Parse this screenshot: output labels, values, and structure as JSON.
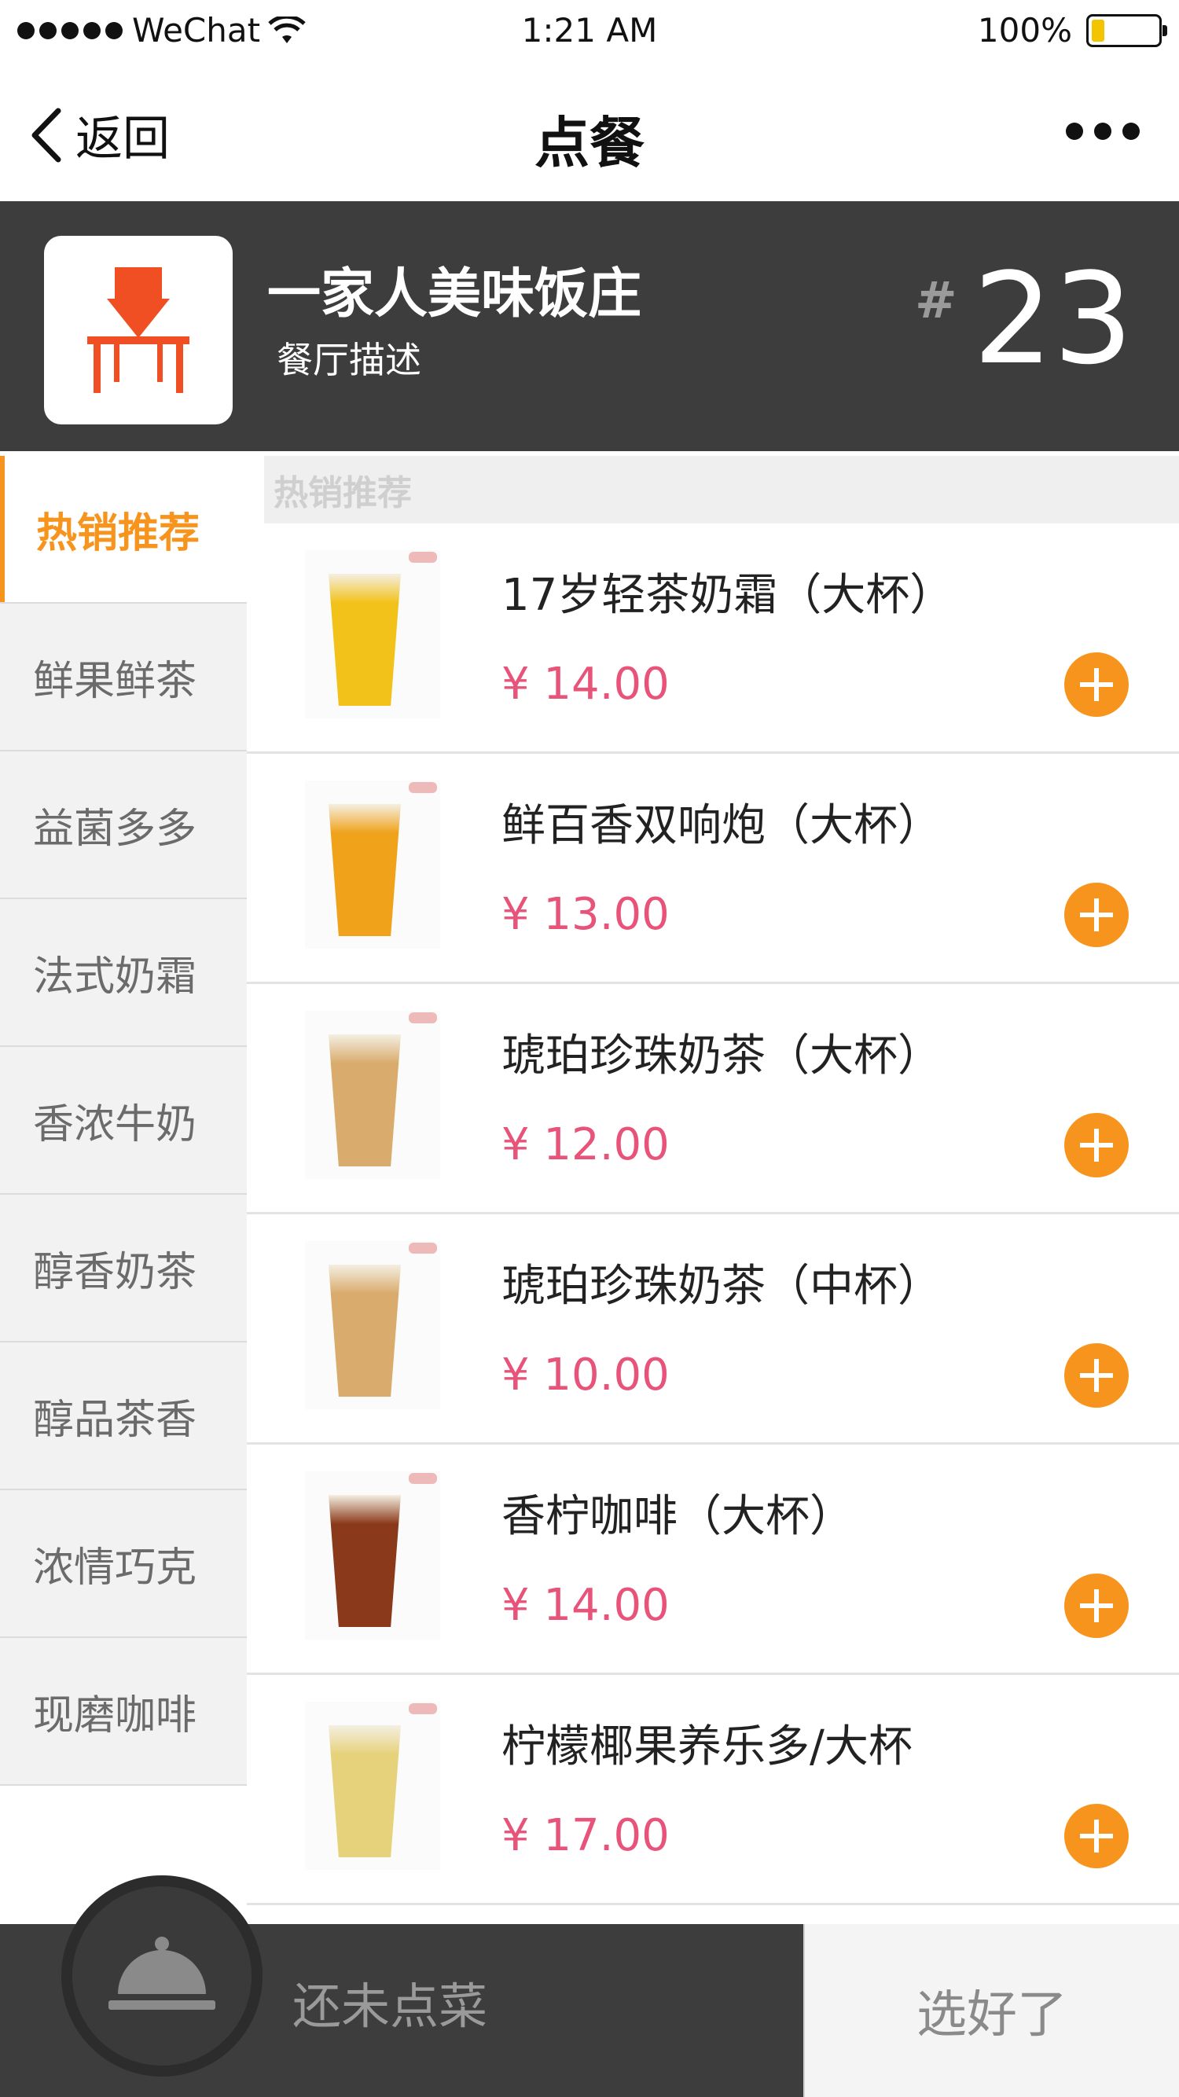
{
  "status_bar": {
    "carrier": "WeChat",
    "time": "1:21 AM",
    "battery_pct": "100%"
  },
  "nav": {
    "back_label": "返回",
    "title": "点餐"
  },
  "restaurant": {
    "name": "一家人美味饭庄",
    "description": "餐厅描述",
    "table_hash": "#",
    "table_number": "23"
  },
  "sidebar": {
    "categories": [
      {
        "label": "热销推荐",
        "active": true
      },
      {
        "label": "鲜果鲜茶"
      },
      {
        "label": "益菌多多"
      },
      {
        "label": "法式奶霜"
      },
      {
        "label": "香浓牛奶"
      },
      {
        "label": "醇香奶茶"
      },
      {
        "label": "醇品茶香"
      },
      {
        "label": "浓情巧克"
      },
      {
        "label": "现磨咖啡"
      }
    ]
  },
  "menu": {
    "section_title": "热销推荐",
    "items": [
      {
        "name": "17岁轻茶奶霜（大杯）",
        "price": "¥ 14.00",
        "color": "#f2c21a"
      },
      {
        "name": "鲜百香双响炮（大杯）",
        "price": "¥ 13.00",
        "color": "#f0a21a"
      },
      {
        "name": "琥珀珍珠奶茶（大杯）",
        "price": "¥ 12.00",
        "color": "#d9ab6c"
      },
      {
        "name": "琥珀珍珠奶茶（中杯）",
        "price": "¥ 10.00",
        "color": "#d9ab6c"
      },
      {
        "name": "香柠咖啡（大杯）",
        "price": "¥ 14.00",
        "color": "#8a3a1a"
      },
      {
        "name": "柠檬椰果养乐多/大杯",
        "price": "¥ 17.00",
        "color": "#e6d27a"
      }
    ]
  },
  "cart": {
    "empty_text": "还未点菜",
    "done_label": "选好了"
  },
  "colors": {
    "accent": "#f7941d",
    "price": "#e8537a",
    "header_bg": "#3d3d3d"
  }
}
